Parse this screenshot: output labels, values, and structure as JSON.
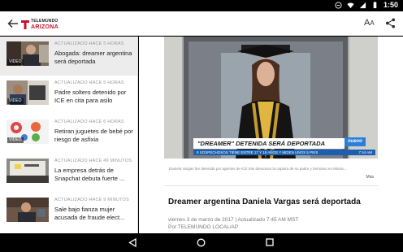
{
  "status_bar": {
    "time": "1:50"
  },
  "app_bar": {
    "logo_top": "TELEMUNDO",
    "logo_sub": "ARIZONA",
    "textsize_large": "A",
    "textsize_small": "A"
  },
  "sidebar": {
    "video_badge": "VIDEO",
    "items": [
      {
        "meta": "ACTUALIZADO HACE 5 HORAS",
        "title": "Abogada: dreamer argentina será deportada",
        "has_video": true
      },
      {
        "meta": "ACTUALIZADO HACE 5 HORAS",
        "title": "Padre soltero detenido por ICE en cita para asilo",
        "has_video": true
      },
      {
        "meta": "ACTUALIZADO HACE 6 HORAS",
        "title": "Retiran juguetes de bebé por riesgo de asfixia",
        "has_video": true
      },
      {
        "meta": "ACTUALIZADO HACE 49 MINUTOS",
        "title": "La empresa detrás de Snapchat debuta fuerte ...",
        "has_video": false
      },
      {
        "meta": "ACTUALIZADO HACE 9 MINUTOS",
        "title": "Sale bajo fianza mujer acusada de fraude elect...",
        "has_video": false
      }
    ]
  },
  "article": {
    "lower_third": "\"DREAMER\" DETENIDA SERÁ DEPORTADA",
    "ticker": "5 SOSPECHOSOS TIENE ENTRE 17 Y 19 AÑOS Y MIDEN UNOS 5 PIES",
    "ticker_time": "7:44 AM",
    "station_logo": "nuevo",
    "caption": "Daniela Vargas fue detenida por agentes de ICE tras denunciar la captura de su padre y hermano en Missis...",
    "more": "Más",
    "headline": "Dreamer argentina Daniela Vargas será deportada",
    "date_line": "viernes 3 de marzo de 2017 | Actualizado 7:45 AM MST",
    "byline": "Por TELEMUNDO LOCAL/AP"
  },
  "colors": {
    "brand_red": "#c8102e",
    "ticker_blue": "#1b5fae",
    "selected_row": "#ececec"
  }
}
